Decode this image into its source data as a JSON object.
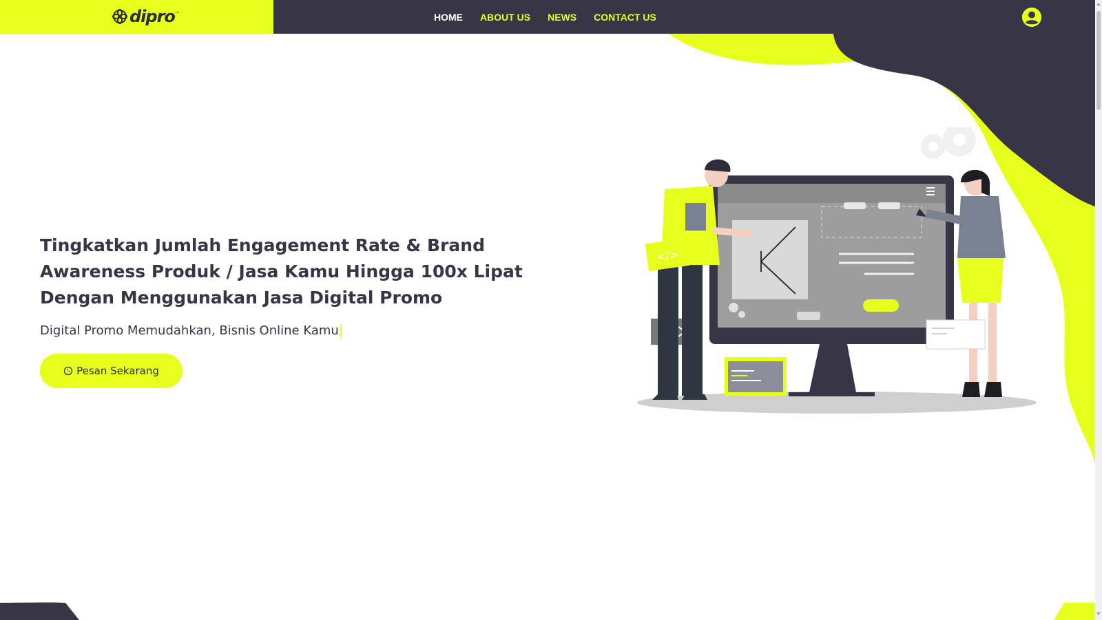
{
  "brand": {
    "logo_text": "dipro",
    "logo_tm": "™",
    "accent_color": "#e6ff1d",
    "dark_color": "#383646"
  },
  "nav": {
    "items": [
      {
        "label": "HOME",
        "active": true
      },
      {
        "label": "ABOUT US",
        "active": false
      },
      {
        "label": "NEWS",
        "active": false
      },
      {
        "label": "CONTACT US",
        "active": false
      }
    ],
    "user_icon": "user-circle-icon"
  },
  "hero": {
    "title": "Tingkatkan Jumlah Engagement Rate & Brand Awareness Produk / Jasa Kamu Hingga 100x Lipat Dengan Menggunakan Jasa Digital Promo",
    "subtitle": "Digital Promo Memudahkan, Bisnis Online Kamu",
    "cta_label": "Pesan Sekarang",
    "cta_icon": "whatsapp-icon"
  },
  "illustration": {
    "icon": "web-design-illustration",
    "code_tag": "</>"
  }
}
